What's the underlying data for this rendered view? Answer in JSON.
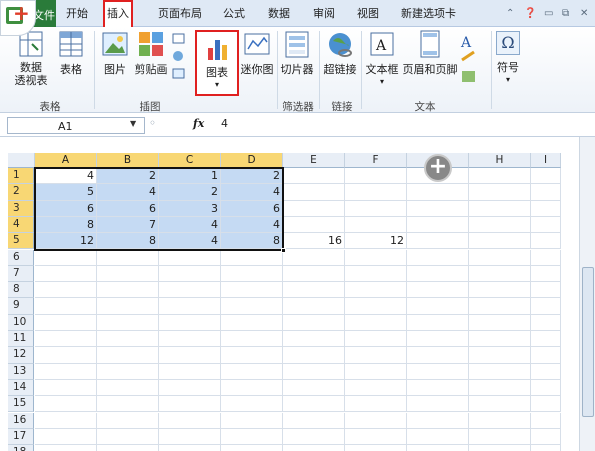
{
  "tabs": {
    "file": "文件",
    "home": "开始",
    "insert": "插入",
    "page_layout": "页面布局",
    "formulas": "公式",
    "data": "数据",
    "review": "审阅",
    "view": "视图",
    "new_tab": "新建选项卡"
  },
  "ribbon": {
    "pivot": "数据\n透视表",
    "table": "表格",
    "picture": "图片",
    "clipart": "剪贴画",
    "chart": "图表",
    "sparkline": "迷你图",
    "slicer": "切片器",
    "hyperlink": "超链接",
    "textbox": "文本框",
    "header_footer": "页眉和页脚",
    "symbol": "符号",
    "groups": {
      "tables": "表格",
      "illustrations": "插图",
      "filter": "筛选器",
      "links": "链接",
      "text": "文本"
    }
  },
  "formula_bar": {
    "name_box": "A1",
    "fx": "fx",
    "value": "4"
  },
  "columns": [
    "A",
    "B",
    "C",
    "D",
    "E",
    "F",
    "G",
    "H",
    "I"
  ],
  "rows": [
    "1",
    "2",
    "3",
    "4",
    "5",
    "6",
    "7",
    "8",
    "9",
    "10",
    "11",
    "12",
    "13",
    "14",
    "15",
    "16",
    "17",
    "18"
  ],
  "cells": [
    [
      "4",
      "2",
      "1",
      "2",
      "",
      "",
      "",
      "",
      ""
    ],
    [
      "5",
      "4",
      "2",
      "4",
      "",
      "",
      "",
      "",
      ""
    ],
    [
      "6",
      "6",
      "3",
      "6",
      "",
      "",
      "",
      "",
      ""
    ],
    [
      "8",
      "7",
      "4",
      "4",
      "",
      "",
      "",
      "",
      ""
    ],
    [
      "12",
      "8",
      "4",
      "8",
      "16",
      "12",
      "",
      "",
      ""
    ]
  ]
}
